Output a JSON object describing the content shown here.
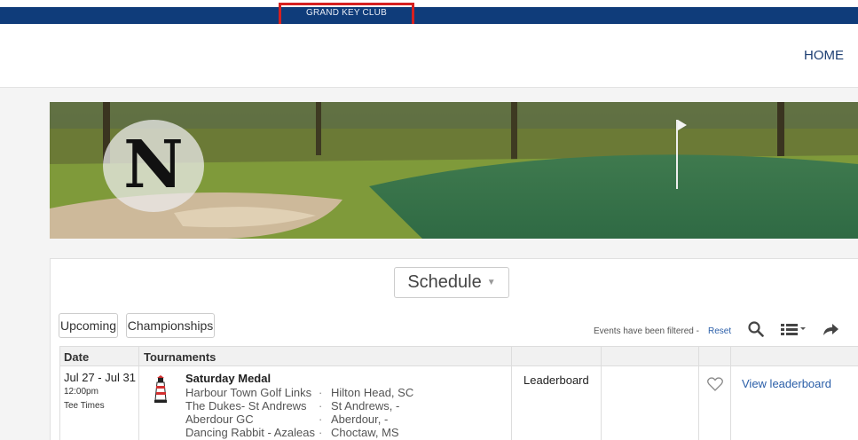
{
  "topbar": {
    "club_name": "GRAND KEY CLUB"
  },
  "nav": {
    "home": "HOME"
  },
  "banner": {
    "logo_letter": "N"
  },
  "schedule": {
    "title": "Schedule",
    "filters": {
      "upcoming": "Upcoming",
      "championships": "Championships"
    },
    "filter_note": "Events have been filtered -",
    "reset": "Reset",
    "icons": {
      "search": "search-icon",
      "view": "list-view-icon",
      "share": "share-icon"
    }
  },
  "table": {
    "headers": {
      "date": "Date",
      "tournaments": "Tournaments"
    },
    "rows": [
      {
        "date": "Jul 27 - Jul 31",
        "time": "12:00pm",
        "tee": "Tee Times",
        "title": "Saturday Medal",
        "courses": [
          {
            "name": "Harbour Town Golf Links",
            "sep": "·",
            "location": "Hilton Head, SC"
          },
          {
            "name": "The Dukes- St Andrews",
            "sep": "·",
            "location": "St Andrews, -"
          },
          {
            "name": "Aberdour GC",
            "sep": "·",
            "location": "Aberdour, -"
          },
          {
            "name": "Dancing Rabbit - Azaleas",
            "sep": "·",
            "location": "Choctaw, MS"
          }
        ],
        "leaderboard": "Leaderboard",
        "view": "View leaderboard"
      }
    ]
  },
  "colors": {
    "topbar": "#0f3c7a",
    "link": "#2a5ea8",
    "highlight": "#d62020"
  }
}
